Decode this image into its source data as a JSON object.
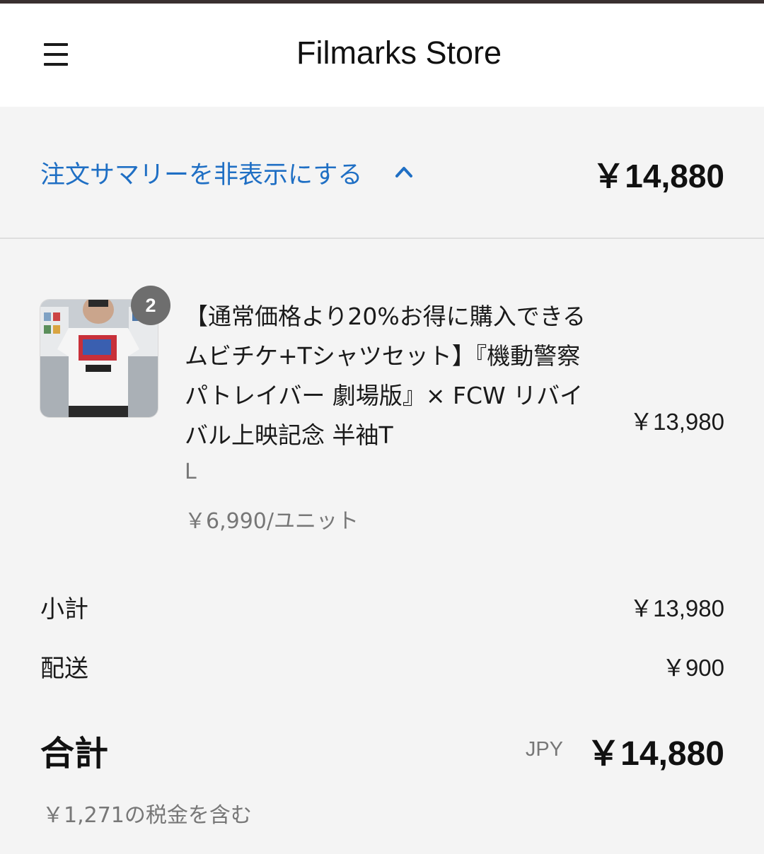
{
  "header": {
    "title": "Filmarks Store",
    "menu_icon": "hamburger-menu-icon"
  },
  "summary": {
    "toggle_label": "注文サマリーを非表示にする",
    "toggle_icon": "chevron-up-icon",
    "total": "￥14,880"
  },
  "item": {
    "quantity": "2",
    "title": "【通常価格より20%お得に購入できるムビチケ+Tシャツセット】『機動警察パトレイバー 劇場版』× FCW リバイバル上映記念 半袖T",
    "variant": "L",
    "unit_price": "￥6,990/ユニット",
    "line_price": "￥13,980"
  },
  "totals": {
    "subtotal_label": "小計",
    "subtotal_value": "￥13,980",
    "shipping_label": "配送",
    "shipping_value": "￥900",
    "total_label": "合計",
    "currency": "JPY",
    "total_value": "￥14,880",
    "tax_note": "￥1,271の税金を含む"
  },
  "colors": {
    "accent": "#1f6fc4",
    "background": "#f4f4f4",
    "header": "#ffffff"
  }
}
